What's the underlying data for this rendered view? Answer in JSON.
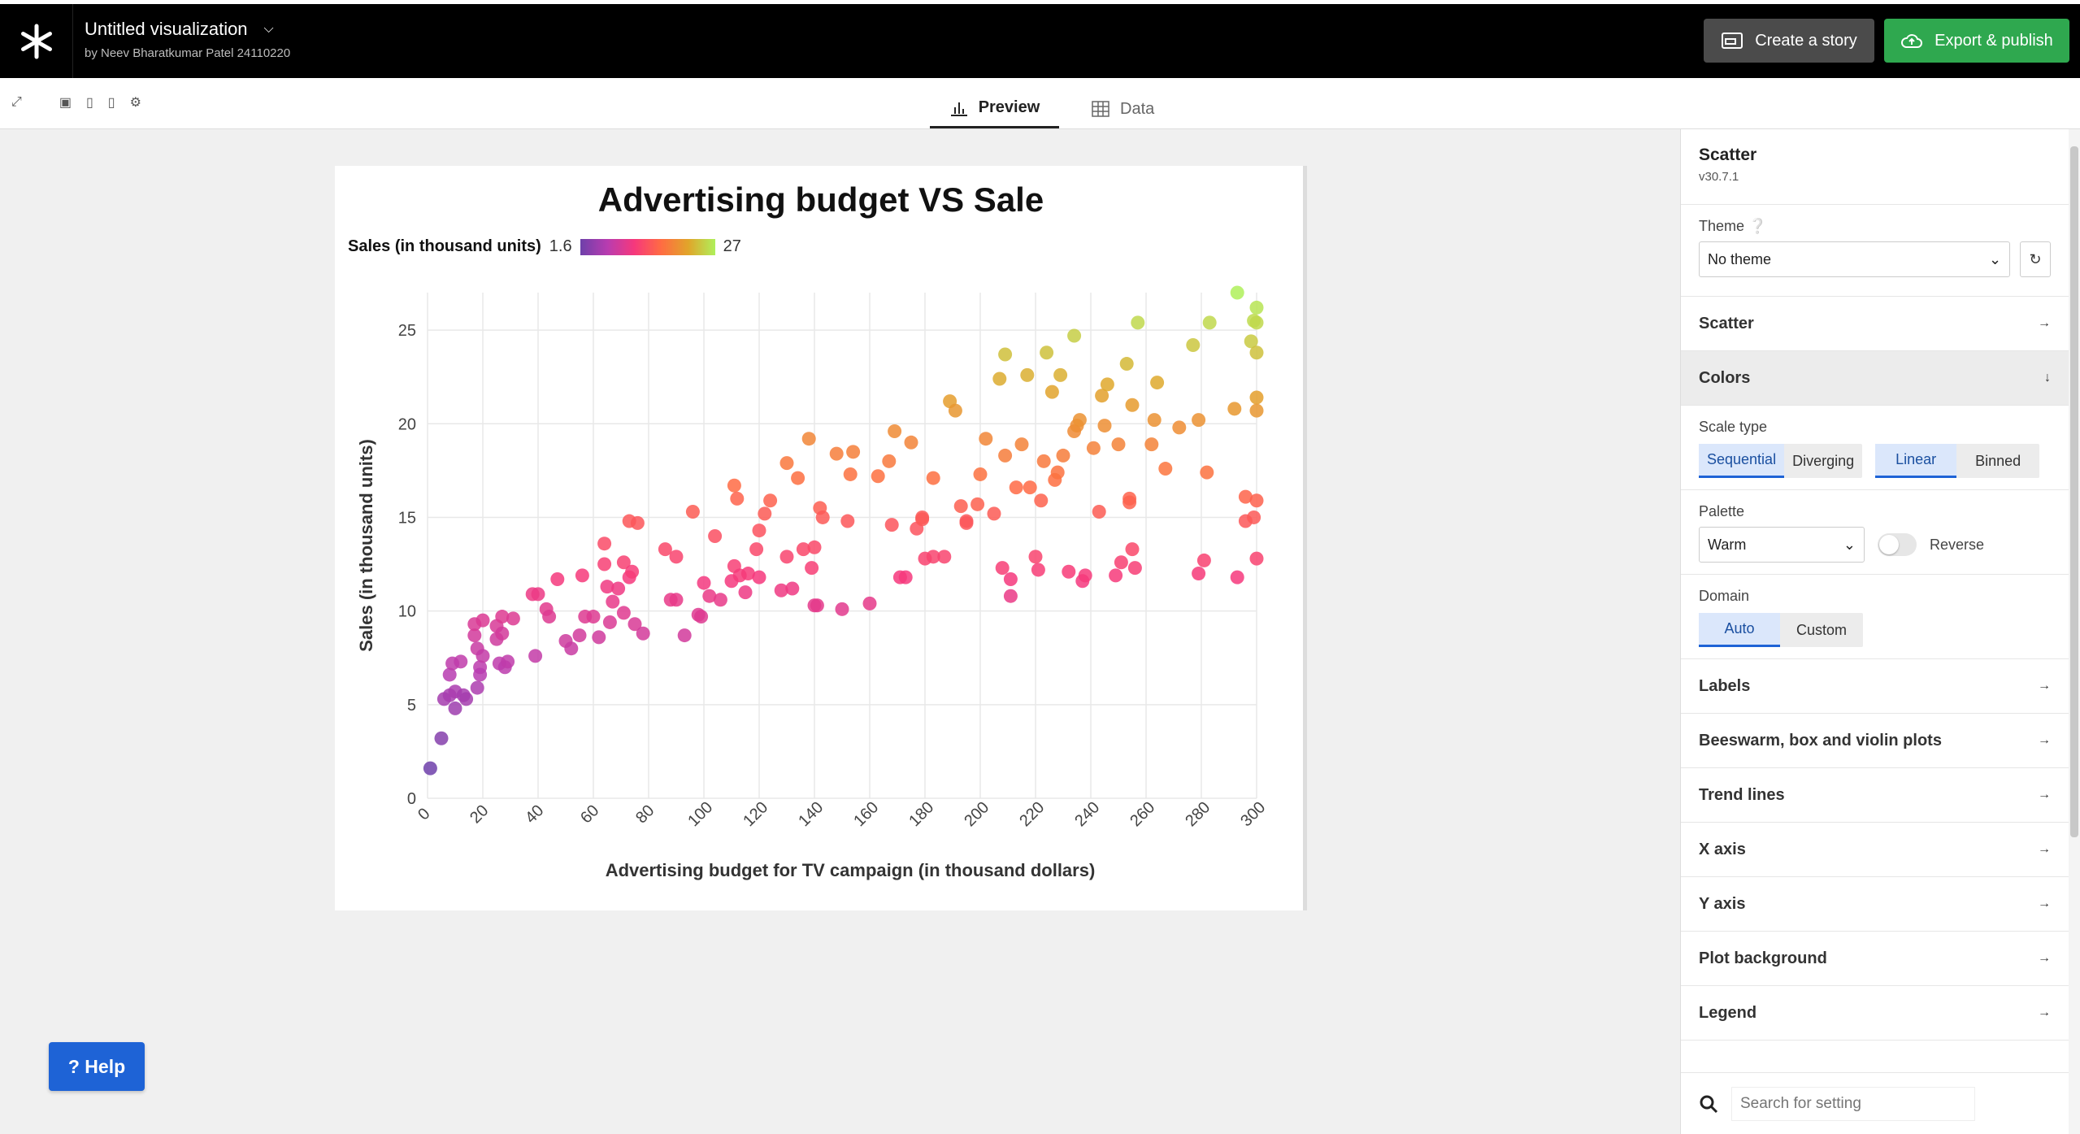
{
  "header": {
    "title": "Untitled visualization",
    "byline": "by Neev Bharatkumar Patel 24110220",
    "story_button": "Create a story",
    "export_button": "Export & publish"
  },
  "tabs": {
    "preview": "Preview",
    "data": "Data"
  },
  "chart_data": {
    "type": "scatter",
    "title": "Advertising budget VS Sale",
    "xlabel": "Advertising budget for TV campaign (in thousand dollars)",
    "ylabel": "Sales (in thousand units)",
    "xlim": [
      0,
      300
    ],
    "ylim": [
      0,
      27
    ],
    "xticks": [
      0,
      20,
      40,
      60,
      80,
      100,
      120,
      140,
      160,
      180,
      200,
      220,
      240,
      260,
      280,
      300
    ],
    "yticks": [
      0,
      5,
      10,
      15,
      20,
      25
    ],
    "grid": true,
    "legend": {
      "title": "Sales (in thousand units)",
      "min": "1.6",
      "max": "27",
      "placement": "top-left",
      "palette": "warm"
    },
    "colors": [
      "#6e40aa",
      "#b83cb0",
      "#f6387c",
      "#ff6c42",
      "#e1a52a",
      "#aff05b"
    ],
    "points": [
      [
        1,
        1.6
      ],
      [
        5,
        3.2
      ],
      [
        6,
        5.3
      ],
      [
        8,
        5.5
      ],
      [
        8,
        6.6
      ],
      [
        9,
        7.2
      ],
      [
        10,
        5.7
      ],
      [
        10,
        4.8
      ],
      [
        12,
        7.3
      ],
      [
        13,
        5.5
      ],
      [
        14,
        5.3
      ],
      [
        17,
        8.7
      ],
      [
        17,
        9.3
      ],
      [
        18,
        8.0
      ],
      [
        18,
        5.9
      ],
      [
        19,
        7.0
      ],
      [
        19,
        6.6
      ],
      [
        20,
        7.6
      ],
      [
        20,
        9.5
      ],
      [
        25,
        9.2
      ],
      [
        25,
        8.5
      ],
      [
        26,
        7.2
      ],
      [
        27,
        9.7
      ],
      [
        27,
        8.8
      ],
      [
        28,
        7.0
      ],
      [
        29,
        7.3
      ],
      [
        31,
        9.6
      ],
      [
        38,
        10.9
      ],
      [
        39,
        7.6
      ],
      [
        40,
        10.9
      ],
      [
        43,
        10.1
      ],
      [
        44,
        9.7
      ],
      [
        47,
        11.7
      ],
      [
        50,
        8.4
      ],
      [
        52,
        8.0
      ],
      [
        55,
        8.7
      ],
      [
        56,
        11.9
      ],
      [
        57,
        9.7
      ],
      [
        60,
        9.7
      ],
      [
        62,
        8.6
      ],
      [
        64,
        12.5
      ],
      [
        64,
        13.6
      ],
      [
        65,
        11.3
      ],
      [
        66,
        9.4
      ],
      [
        67,
        10.5
      ],
      [
        69,
        11.2
      ],
      [
        71,
        12.6
      ],
      [
        71,
        9.9
      ],
      [
        73,
        11.8
      ],
      [
        73,
        14.8
      ],
      [
        74,
        12.1
      ],
      [
        75,
        9.3
      ],
      [
        76,
        14.7
      ],
      [
        78,
        8.8
      ],
      [
        86,
        13.3
      ],
      [
        88,
        10.6
      ],
      [
        90,
        12.9
      ],
      [
        90,
        10.6
      ],
      [
        93,
        8.7
      ],
      [
        96,
        15.3
      ],
      [
        98,
        9.8
      ],
      [
        99,
        9.7
      ],
      [
        100,
        11.5
      ],
      [
        102,
        10.8
      ],
      [
        104,
        14.0
      ],
      [
        106,
        10.6
      ],
      [
        110,
        11.6
      ],
      [
        111,
        12.4
      ],
      [
        111,
        16.7
      ],
      [
        112,
        16.0
      ],
      [
        113,
        11.9
      ],
      [
        115,
        11.0
      ],
      [
        116,
        12.0
      ],
      [
        119,
        13.3
      ],
      [
        120,
        11.8
      ],
      [
        120,
        14.3
      ],
      [
        122,
        15.2
      ],
      [
        124,
        15.9
      ],
      [
        128,
        11.1
      ],
      [
        130,
        17.9
      ],
      [
        130,
        12.9
      ],
      [
        132,
        11.2
      ],
      [
        134,
        17.1
      ],
      [
        136,
        13.3
      ],
      [
        138,
        19.2
      ],
      [
        139,
        12.3
      ],
      [
        140,
        13.4
      ],
      [
        140,
        10.3
      ],
      [
        141,
        10.3
      ],
      [
        142,
        15.5
      ],
      [
        143,
        15.0
      ],
      [
        148,
        18.4
      ],
      [
        150,
        10.1
      ],
      [
        152,
        14.8
      ],
      [
        153,
        17.3
      ],
      [
        154,
        18.5
      ],
      [
        160,
        10.4
      ],
      [
        163,
        17.2
      ],
      [
        167,
        18.0
      ],
      [
        168,
        14.6
      ],
      [
        169,
        19.6
      ],
      [
        171,
        11.8
      ],
      [
        173,
        11.8
      ],
      [
        175,
        19.0
      ],
      [
        177,
        14.4
      ],
      [
        179,
        14.9
      ],
      [
        179,
        15.0
      ],
      [
        180,
        12.8
      ],
      [
        183,
        17.1
      ],
      [
        183,
        12.9
      ],
      [
        187,
        12.9
      ],
      [
        189,
        21.2
      ],
      [
        191,
        20.7
      ],
      [
        193,
        15.6
      ],
      [
        195,
        14.8
      ],
      [
        195,
        14.7
      ],
      [
        199,
        15.7
      ],
      [
        200,
        17.3
      ],
      [
        202,
        19.2
      ],
      [
        205,
        15.2
      ],
      [
        207,
        22.4
      ],
      [
        208,
        12.3
      ],
      [
        209,
        18.3
      ],
      [
        209,
        23.7
      ],
      [
        211,
        11.7
      ],
      [
        211,
        10.8
      ],
      [
        213,
        16.6
      ],
      [
        215,
        18.9
      ],
      [
        217,
        22.6
      ],
      [
        218,
        16.6
      ],
      [
        220,
        12.9
      ],
      [
        221,
        12.2
      ],
      [
        222,
        15.9
      ],
      [
        223,
        18.0
      ],
      [
        224,
        23.8
      ],
      [
        226,
        21.7
      ],
      [
        227,
        17.0
      ],
      [
        228,
        17.4
      ],
      [
        229,
        22.6
      ],
      [
        230,
        18.3
      ],
      [
        232,
        12.1
      ],
      [
        234,
        19.6
      ],
      [
        234,
        24.7
      ],
      [
        235,
        19.9
      ],
      [
        236,
        20.2
      ],
      [
        237,
        11.6
      ],
      [
        238,
        11.9
      ],
      [
        241,
        18.7
      ],
      [
        243,
        15.3
      ],
      [
        244,
        21.5
      ],
      [
        245,
        19.9
      ],
      [
        246,
        22.1
      ],
      [
        249,
        11.9
      ],
      [
        250,
        18.9
      ],
      [
        251,
        12.6
      ],
      [
        253,
        23.2
      ],
      [
        254,
        16.0
      ],
      [
        254,
        15.8
      ],
      [
        255,
        21.0
      ],
      [
        255,
        13.3
      ],
      [
        256,
        12.3
      ],
      [
        257,
        25.4
      ],
      [
        262,
        18.9
      ],
      [
        263,
        20.2
      ],
      [
        264,
        22.2
      ],
      [
        267,
        17.6
      ],
      [
        272,
        19.8
      ],
      [
        277,
        24.2
      ],
      [
        279,
        20.2
      ],
      [
        279,
        12.0
      ],
      [
        281,
        12.7
      ],
      [
        282,
        17.4
      ],
      [
        283,
        25.4
      ],
      [
        292,
        20.8
      ],
      [
        293,
        11.8
      ],
      [
        293,
        27.0
      ],
      [
        296,
        16.1
      ],
      [
        296,
        14.8
      ],
      [
        298,
        24.4
      ],
      [
        299,
        25.5
      ],
      [
        299,
        15.0
      ],
      [
        301,
        15.9
      ],
      [
        302,
        26.2
      ],
      [
        304,
        25.4
      ],
      [
        305,
        12.8
      ],
      [
        307,
        21.4
      ],
      [
        308,
        20.7
      ],
      [
        310,
        23.8
      ]
    ]
  },
  "sidebar": {
    "name": "Scatter",
    "version": "v30.7.1",
    "theme_label": "Theme",
    "theme_value": "No theme",
    "sections": [
      "Scatter",
      "Colors",
      "Labels",
      "Beeswarm, box and violin plots",
      "Trend lines",
      "X axis",
      "Y axis",
      "Plot background",
      "Legend"
    ],
    "scale_type_label": "Scale type",
    "scale_options": [
      "Sequential",
      "Diverging"
    ],
    "interp_options": [
      "Linear",
      "Binned"
    ],
    "palette_label": "Palette",
    "palette_value": "Warm",
    "reverse_label": "Reverse",
    "domain_label": "Domain",
    "domain_options": [
      "Auto",
      "Custom"
    ],
    "search_placeholder": "Search for setting"
  },
  "help_label": "? Help"
}
